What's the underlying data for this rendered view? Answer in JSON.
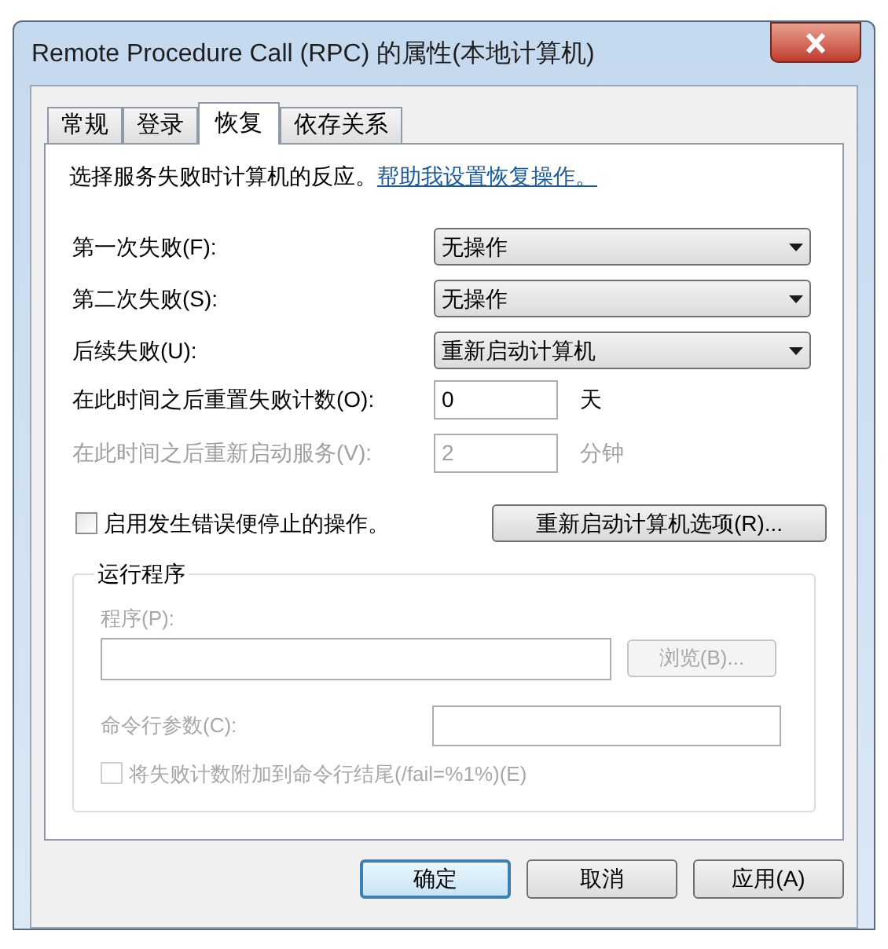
{
  "window": {
    "title": "Remote Procedure Call (RPC) 的属性(本地计算机)"
  },
  "tabs": [
    {
      "label": "常规",
      "selected": false
    },
    {
      "label": "登录",
      "selected": false
    },
    {
      "label": "恢复",
      "selected": true
    },
    {
      "label": "依存关系",
      "selected": false
    }
  ],
  "description": "选择服务失败时计算机的反应。",
  "help_link": "帮助我设置恢复操作。",
  "failure_actions": [
    {
      "label": "第一次失败(F):",
      "value": "无操作"
    },
    {
      "label": "第二次失败(S):",
      "value": "无操作"
    },
    {
      "label": "后续失败(U):",
      "value": "重新启动计算机"
    }
  ],
  "counters": [
    {
      "label": "在此时间之后重置失败计数(O):",
      "value": "0",
      "unit": "天",
      "disabled": false
    },
    {
      "label": "在此时间之后重新启动服务(V):",
      "value": "2",
      "unit": "分钟",
      "disabled": true
    }
  ],
  "enable_actions": {
    "label": "启用发生错误便停止的操作。",
    "checked": false
  },
  "restart_options_button": "重新启动计算机选项(R)...",
  "run_program": {
    "title": "运行程序",
    "disabled": true,
    "program_label": "程序(P):",
    "browse_button": "浏览(B)...",
    "params_label": "命令行参数(C):",
    "append": {
      "label": "将失败计数附加到命令行结尾(/fail=%1%)(E)",
      "checked": false
    }
  },
  "buttons": [
    {
      "label": "确定",
      "default": true
    },
    {
      "label": "取消",
      "default": false
    },
    {
      "label": "应用(A)",
      "default": false
    }
  ]
}
